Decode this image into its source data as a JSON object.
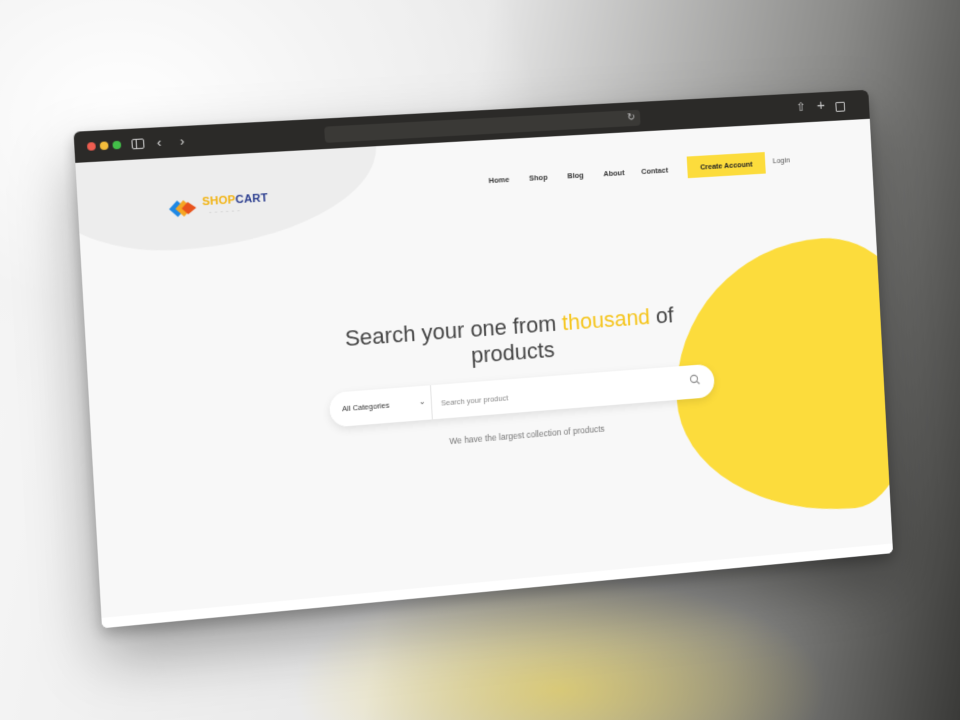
{
  "browser": {
    "back_icon": "chevron-left-icon",
    "forward_icon": "chevron-right-icon",
    "reload_icon": "reload-icon",
    "share_icon": "share-icon",
    "new_tab_icon": "plus-icon",
    "tabs_icon": "tab-overview-icon"
  },
  "logo": {
    "part1": "SHOP",
    "part2": "CART",
    "tagline": "~ ~ ~ ~ ~ ~"
  },
  "nav": {
    "home": "Home",
    "shop": "Shop",
    "blog": "Blog",
    "about": "About",
    "contact": "Contact",
    "create_account": "Create Account",
    "login": "Login"
  },
  "hero": {
    "headline_before": "Search your one from ",
    "headline_highlight": "thousand",
    "headline_after": " of products",
    "category_selected": "All Categories",
    "search_placeholder": "Search your product",
    "tagline": "We have the largest collection of products"
  },
  "colors": {
    "accent_yellow": "#fcdc3c",
    "highlight_text": "#f5c51c",
    "logo_blue": "#2c3e8f",
    "titlebar": "#2b2a28"
  }
}
